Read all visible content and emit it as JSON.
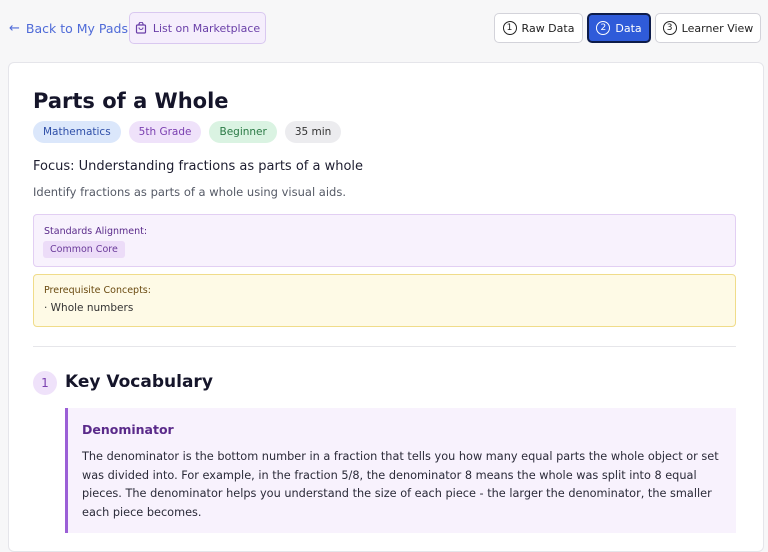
{
  "header": {
    "back_label": "Back to My Pads",
    "marketplace_label": "List on Marketplace",
    "views": [
      {
        "num": "1",
        "label": "Raw Data",
        "active": false
      },
      {
        "num": "2",
        "label": "Data",
        "active": true
      },
      {
        "num": "3",
        "label": "Learner View",
        "active": false
      }
    ]
  },
  "lesson": {
    "title": "Parts of a Whole",
    "tags": [
      "Mathematics",
      "5th Grade",
      "Beginner",
      "35 min"
    ],
    "focus": "Focus: Understanding fractions as parts of a whole",
    "description": "Identify fractions as parts of a whole using visual aids.",
    "standards": {
      "label": "Standards Alignment:",
      "items": [
        "Common Core"
      ]
    },
    "prerequisites": {
      "label": "Prerequisite Concepts:",
      "items": [
        "· Whole numbers"
      ]
    }
  },
  "sections": [
    {
      "number": "1",
      "title": "Key Vocabulary",
      "vocab": [
        {
          "term": "Denominator",
          "definition": "The denominator is the bottom number in a fraction that tells you how many equal parts the whole object or set was divided into. For example, in the fraction 5/8, the denominator 8 means the whole was split into 8 equal pieces. The denominator helps you understand the size of each piece - the larger the denominator, the smaller each piece becomes."
        }
      ]
    }
  ],
  "colors": {
    "accent": "#2f5bd9",
    "link": "#4f6bd8",
    "purple": "#9b5fd6"
  }
}
